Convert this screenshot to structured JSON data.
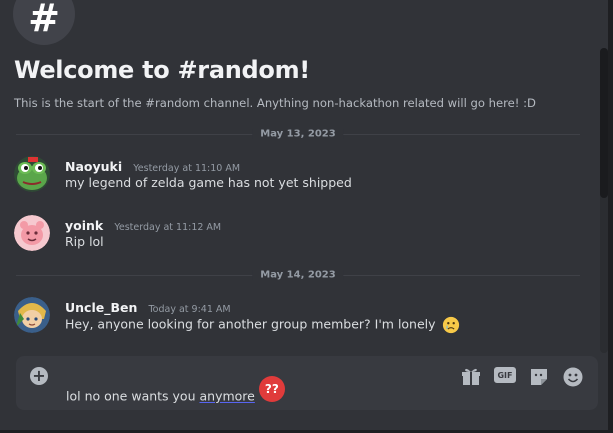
{
  "channel": {
    "icon_glyph": "#",
    "welcome_title": "Welcome to #random!",
    "description": "This is the start of the #random channel. Anything non-hackathon related will go here! :D"
  },
  "dividers": [
    "May 13, 2023",
    "May 14, 2023"
  ],
  "messages": [
    {
      "author": "Naoyuki",
      "timestamp": "Yesterday at 11:10 AM",
      "text": "my legend of zelda game has not yet shipped",
      "avatar": "green-frog-avatar"
    },
    {
      "author": "yoink",
      "timestamp": "Yesterday at 11:12 AM",
      "text": "Rip lol",
      "avatar": "pink-creature-avatar"
    },
    {
      "author": "Uncle_Ben",
      "timestamp": "Today at 9:41 AM",
      "text": "Hey, anyone looking for another group member? I'm lonely",
      "avatar": "link-avatar",
      "emoji": "crying-face-emoji"
    }
  ],
  "composer": {
    "text_before": "lol no one wants you ",
    "text_underlined": "anymore",
    "sticker": "??",
    "gif_label": "GIF",
    "tools": [
      "gift-icon",
      "gif-button",
      "sticker-icon",
      "emoji-icon"
    ]
  },
  "colors": {
    "background": "#313338",
    "composer_bg": "#383a40",
    "sticker_red": "#e03b3b",
    "text": "#dbdee1"
  }
}
